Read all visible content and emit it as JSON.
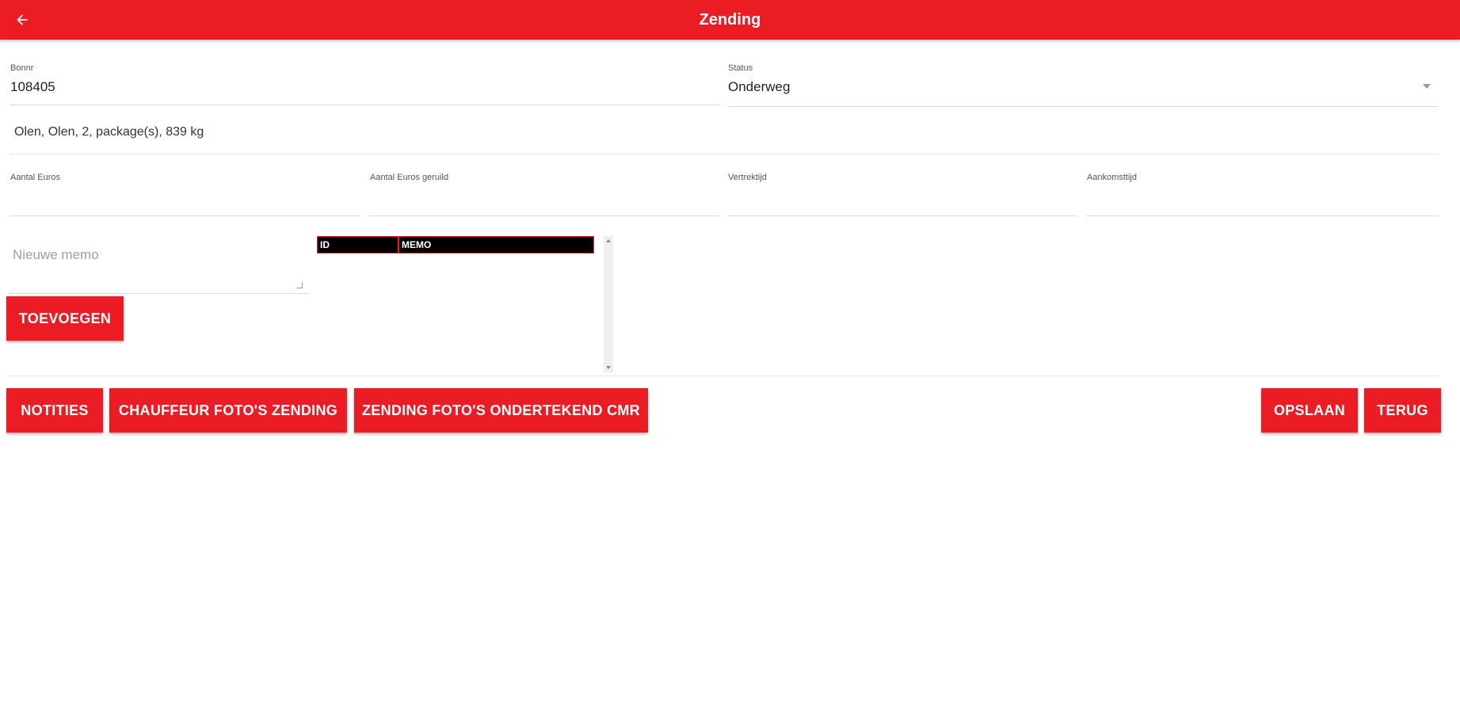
{
  "header": {
    "title": "Zending",
    "back_icon": "arrow-left-icon"
  },
  "form": {
    "bonnr": {
      "label": "Bonnr",
      "value": "108405"
    },
    "status": {
      "label": "Status",
      "value": "Onderweg"
    },
    "summary": "Olen, Olen, 2, package(s), 839 kg",
    "aantal_euros": {
      "label": "Aantal Euros",
      "value": ""
    },
    "aantal_euros_geruild": {
      "label": "Aantal Euros geruild",
      "value": ""
    },
    "vertrektijd": {
      "label": "Vertrektijd",
      "value": ""
    },
    "aankomsttijd": {
      "label": "Aankomsttijd",
      "value": ""
    },
    "memo": {
      "placeholder": "Nieuwe memo",
      "add_label": "TOEVOEGEN"
    }
  },
  "memo_table": {
    "columns": [
      "ID",
      "MEMO"
    ],
    "rows": []
  },
  "actions": {
    "notities": "NOTITIES",
    "chauffeur_fotos": "CHAUFFEUR FOTO'S ZENDING",
    "zending_fotos": "ZENDING FOTO'S ONDERTEKEND CMR",
    "opslaan": "OPSLAAN",
    "terug": "TERUG"
  },
  "colors": {
    "accent": "#ec1c24",
    "background": "#ffffff"
  }
}
